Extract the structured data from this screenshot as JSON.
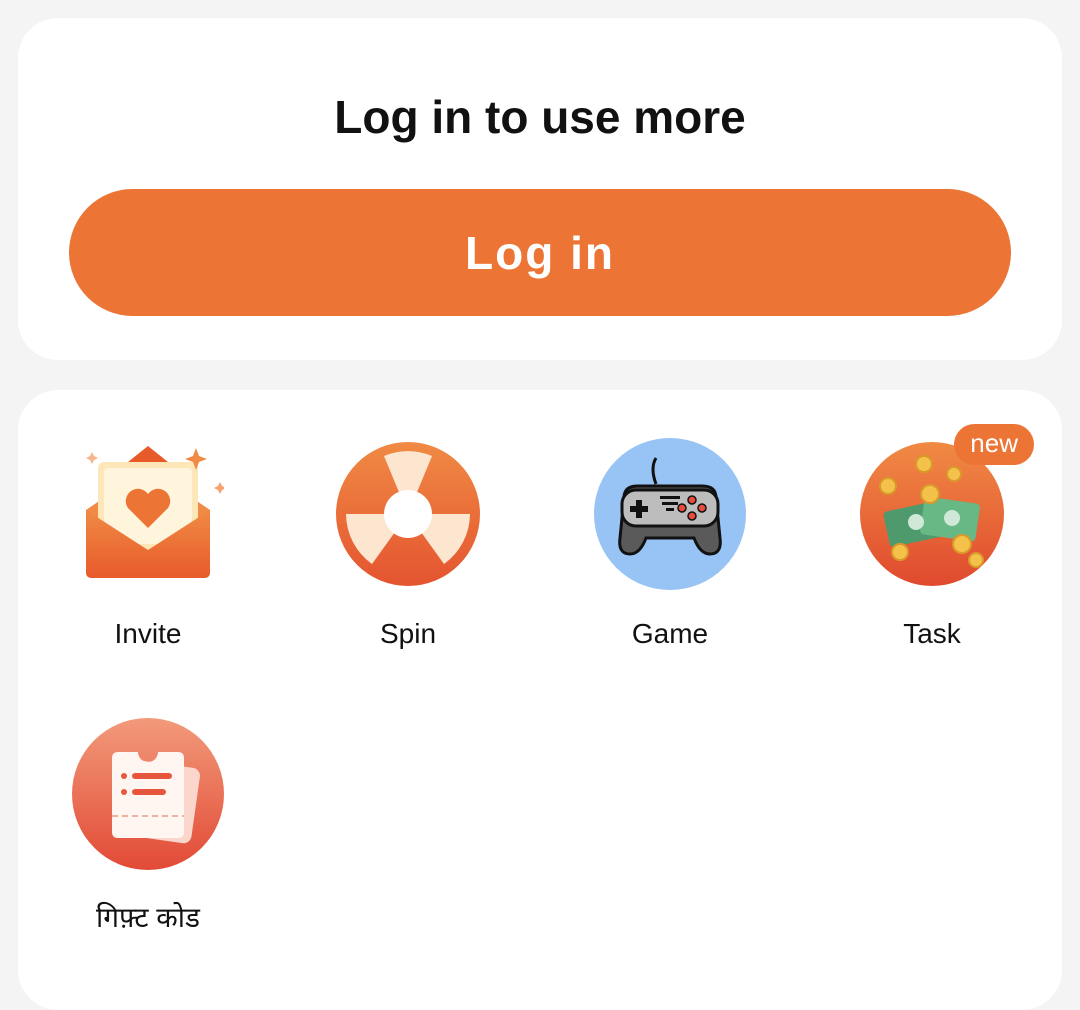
{
  "login": {
    "title": "Log in to use more",
    "button_label": "Log in",
    "accent": "#ec7435"
  },
  "features": [
    {
      "id": "invite",
      "label": "Invite",
      "icon": "invite-envelope-icon"
    },
    {
      "id": "spin",
      "label": "Spin",
      "icon": "spin-wheel-icon"
    },
    {
      "id": "game",
      "label": "Game",
      "icon": "gamepad-icon"
    },
    {
      "id": "task",
      "label": "Task",
      "icon": "money-task-icon",
      "badge": "new"
    },
    {
      "id": "gift-code",
      "label": "गिफ़्ट कोड",
      "icon": "gift-code-ticket-icon"
    }
  ]
}
